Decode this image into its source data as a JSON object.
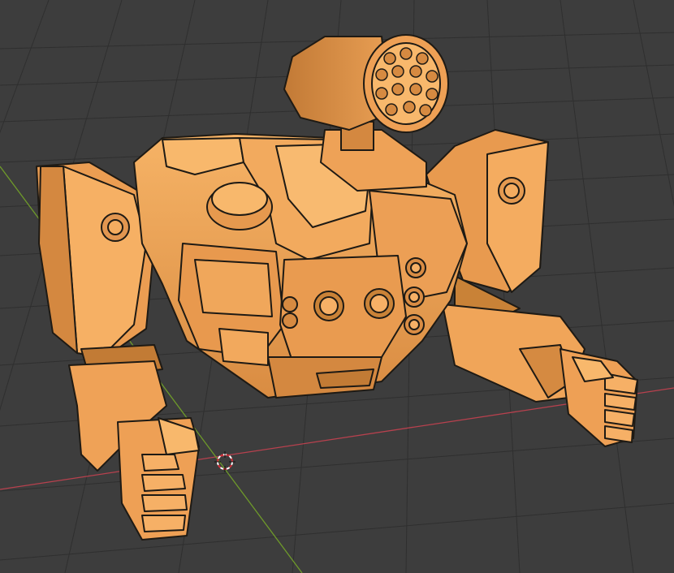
{
  "viewport": {
    "background_color": "#3d3d3d",
    "grid_color": "#2f2f2f",
    "x_axis_color": "#b8414e",
    "y_axis_color": "#6e9a2a",
    "model_color": "#f0a85a",
    "model_shadow_color": "#c07a38",
    "outline_color": "#1e1a14"
  },
  "scene": {
    "object": "mech-robot",
    "cursor": "3d-cursor"
  }
}
